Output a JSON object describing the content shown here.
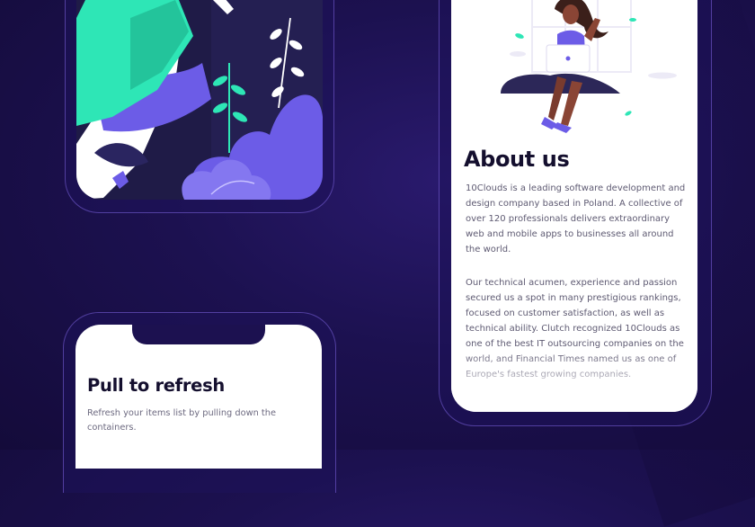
{
  "screens": {
    "refresh": {
      "title": "Pull to refresh",
      "description": "Refresh your items list by pulling down the containers."
    },
    "about": {
      "title": "About us",
      "paragraph1": "10Clouds is a leading software development and design company based in Poland. A collective of over 120 professionals delivers extraordinary web and mobile apps to businesses all around the world.",
      "paragraph2": "Our technical acumen, experience and passion secured us a spot in many prestigious rankings, focused on customer satisfaction, as well as technical ability. Clutch recognized 10Clouds as one of the best IT outsourcing companies on the world, and Financial Times named us as one of Europe's fastest growing companies."
    }
  },
  "colors": {
    "background": "#1c1150",
    "accent_purple": "#6c5ce7",
    "accent_teal": "#2ee6b6",
    "heading": "#140f2e",
    "body_text": "#5e5a72"
  },
  "illustrations": {
    "top_left": "woman-walking-illustration",
    "about": "woman-with-laptop-illustration"
  }
}
